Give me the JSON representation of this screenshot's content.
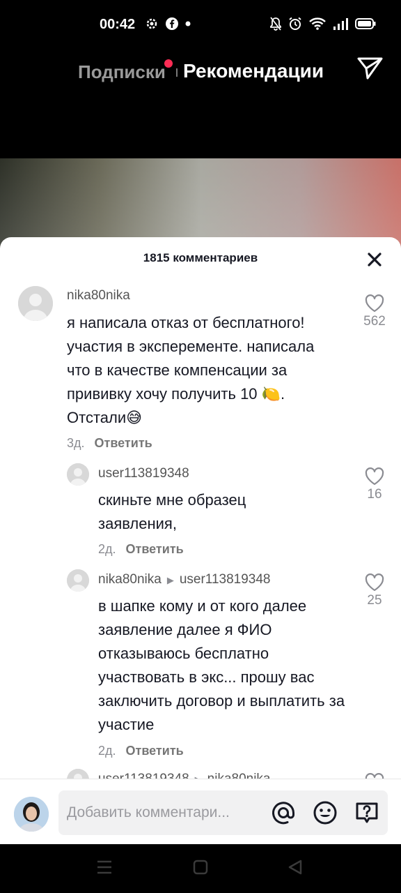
{
  "status_bar": {
    "time": "00:42",
    "left_icons": [
      "settings-icon",
      "facebook-icon",
      "dot-icon"
    ],
    "right_icons": [
      "mute-icon",
      "alarm-icon",
      "wifi-icon",
      "signal-icon",
      "battery-icon"
    ]
  },
  "top_nav": {
    "following_label": "Подписки",
    "for_you_label": "Рекомендации",
    "accent_color": "#fe2c55"
  },
  "comments_sheet": {
    "title": "1815 комментариев",
    "comments": [
      {
        "username": "nika80nika",
        "text": "я написала отказ от бесплатного! участия в эксперементе. написала что в качестве компенсации за прививку хочу получить 10 🍋. Отстали😅",
        "age": "3д.",
        "reply_label": "Ответить",
        "likes": "562"
      },
      {
        "username": "user113819348",
        "text": "скиньте мне образец заявления,",
        "age": "2д.",
        "reply_label": "Ответить",
        "likes": "16"
      },
      {
        "username": "nika80nika",
        "reply_to": "user113819348",
        "text": "в шапке кому и от кого далее заявление далее я ФИО отказываюсь бесплатно участвовать в экс... прошу вас заключить договор и выплатить за участие",
        "age": "2д.",
        "reply_label": "Ответить",
        "likes": "25"
      },
      {
        "username": "user113819348",
        "reply_to": "nika80nika"
      }
    ]
  },
  "input_bar": {
    "placeholder": "Добавить комментари...",
    "icons": [
      "mention-icon",
      "emoji-icon",
      "question-icon"
    ]
  }
}
